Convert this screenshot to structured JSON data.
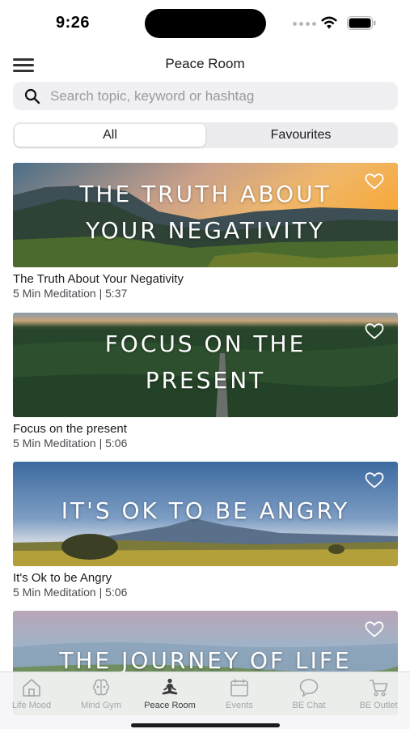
{
  "status_bar": {
    "time": "9:26"
  },
  "header": {
    "title": "Peace Room"
  },
  "search": {
    "placeholder": "Search topic, keyword or hashtag",
    "value": ""
  },
  "segments": {
    "all": "All",
    "favourites": "Favourites",
    "selected": "All"
  },
  "cards": [
    {
      "overlay_line1": "THE TRUTH ABOUT",
      "overlay_line2": "YOUR NEGATIVITY",
      "title": "The Truth About Your Negativity",
      "meta": "5 Min Meditation | 5:37",
      "favourited": false
    },
    {
      "overlay_line1": "FOCUS ON THE",
      "overlay_line2": "PRESENT",
      "title": "Focus on the present",
      "meta": "5 Min Meditation | 5:06",
      "favourited": false
    },
    {
      "overlay_line1": "IT'S OK TO BE ANGRY",
      "overlay_line2": "",
      "title": "It's Ok to be Angry",
      "meta": "5 Min Meditation | 5:06",
      "favourited": false
    },
    {
      "overlay_line1": "THE JOURNEY OF LIFE",
      "overlay_line2": "",
      "title": "",
      "meta": "",
      "favourited": false
    }
  ],
  "tabs": [
    {
      "label": "Life Mood",
      "icon": "home-icon"
    },
    {
      "label": "Mind Gym",
      "icon": "brain-icon"
    },
    {
      "label": "Peace Room",
      "icon": "meditation-icon",
      "active": true
    },
    {
      "label": "Events",
      "icon": "calendar-icon"
    },
    {
      "label": "BE Chat",
      "icon": "chat-bubble-icon"
    },
    {
      "label": "BE Outlet",
      "icon": "cart-icon"
    }
  ],
  "colors": {
    "accent": "#1c1c1e",
    "inactive_tab": "#a5a5aa",
    "search_bg": "#f0f0f2"
  }
}
